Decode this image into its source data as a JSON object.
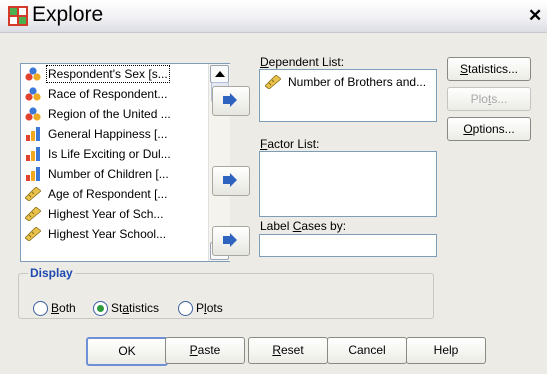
{
  "window": {
    "title": "Explore",
    "close_glyph": "✕"
  },
  "variables": [
    {
      "label": "Respondent's Sex [s...",
      "icon": "nominal-icon",
      "selected": true
    },
    {
      "label": "Race of Respondent...",
      "icon": "nominal-icon"
    },
    {
      "label": "Region of the United ...",
      "icon": "nominal-icon"
    },
    {
      "label": "General Happiness [...",
      "icon": "ordinal-icon"
    },
    {
      "label": "Is Life Exciting or Dul...",
      "icon": "ordinal-icon"
    },
    {
      "label": "Number of Children [...",
      "icon": "ordinal-icon"
    },
    {
      "label": "Age of Respondent [...",
      "icon": "scale-icon"
    },
    {
      "label": "Highest Year of Sch...",
      "icon": "scale-icon"
    },
    {
      "label": "Highest Year School...",
      "icon": "scale-icon"
    }
  ],
  "dependent_list": {
    "label_pre": "",
    "label_key": "D",
    "label_post": "ependent List:",
    "items": [
      {
        "label": "Number of Brothers and...",
        "icon": "scale-icon"
      }
    ]
  },
  "factor_list": {
    "label_pre": "",
    "label_key": "F",
    "label_post": "actor List:"
  },
  "label_cases": {
    "label_pre": "Label ",
    "label_key": "C",
    "label_post": "ases by:"
  },
  "side_buttons": {
    "statistics": {
      "pre": "",
      "key": "S",
      "post": "tatistics..."
    },
    "plots": {
      "pre": "Plo",
      "key": "t",
      "post": "s..."
    },
    "options": {
      "pre": "",
      "key": "O",
      "post": "ptions..."
    }
  },
  "display": {
    "title": "Display",
    "both": {
      "pre": "",
      "key": "B",
      "post": "oth"
    },
    "statistics": {
      "pre": "St",
      "key": "a",
      "post": "tistics"
    },
    "plots": {
      "pre": "P",
      "key": "l",
      "post": "ots"
    },
    "selected": "statistics"
  },
  "bottom_buttons": {
    "ok": "OK",
    "paste": {
      "pre": "",
      "key": "P",
      "post": "aste"
    },
    "reset": {
      "pre": "",
      "key": "R",
      "post": "eset"
    },
    "cancel": "Cancel",
    "help": "Help"
  },
  "colors": {
    "accent": "#1f4ab0",
    "field_border": "#7f9db9",
    "arrow_blue": "#2f63c0",
    "radio_dot": "#2d9a3c"
  }
}
